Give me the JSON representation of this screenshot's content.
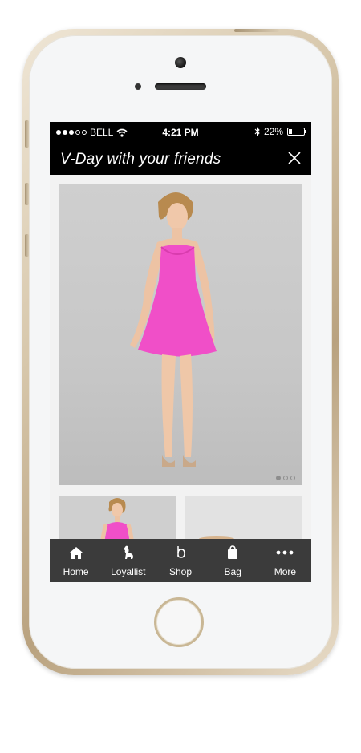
{
  "status_bar": {
    "carrier": "BELL",
    "time": "4:21 PM",
    "battery": "22%",
    "battery_level": 0.22
  },
  "header": {
    "title": "V-Day with your friends",
    "close_icon": "close-icon"
  },
  "gallery": {
    "page_count": 3,
    "current_page": 1
  },
  "tabs": [
    {
      "label": "Home",
      "icon": "home-icon"
    },
    {
      "label": "Loyallist",
      "icon": "dog-icon"
    },
    {
      "label": "Shop",
      "icon": "shop-logo-icon"
    },
    {
      "label": "Bag",
      "icon": "bag-icon"
    },
    {
      "label": "More",
      "icon": "more-icon"
    }
  ]
}
